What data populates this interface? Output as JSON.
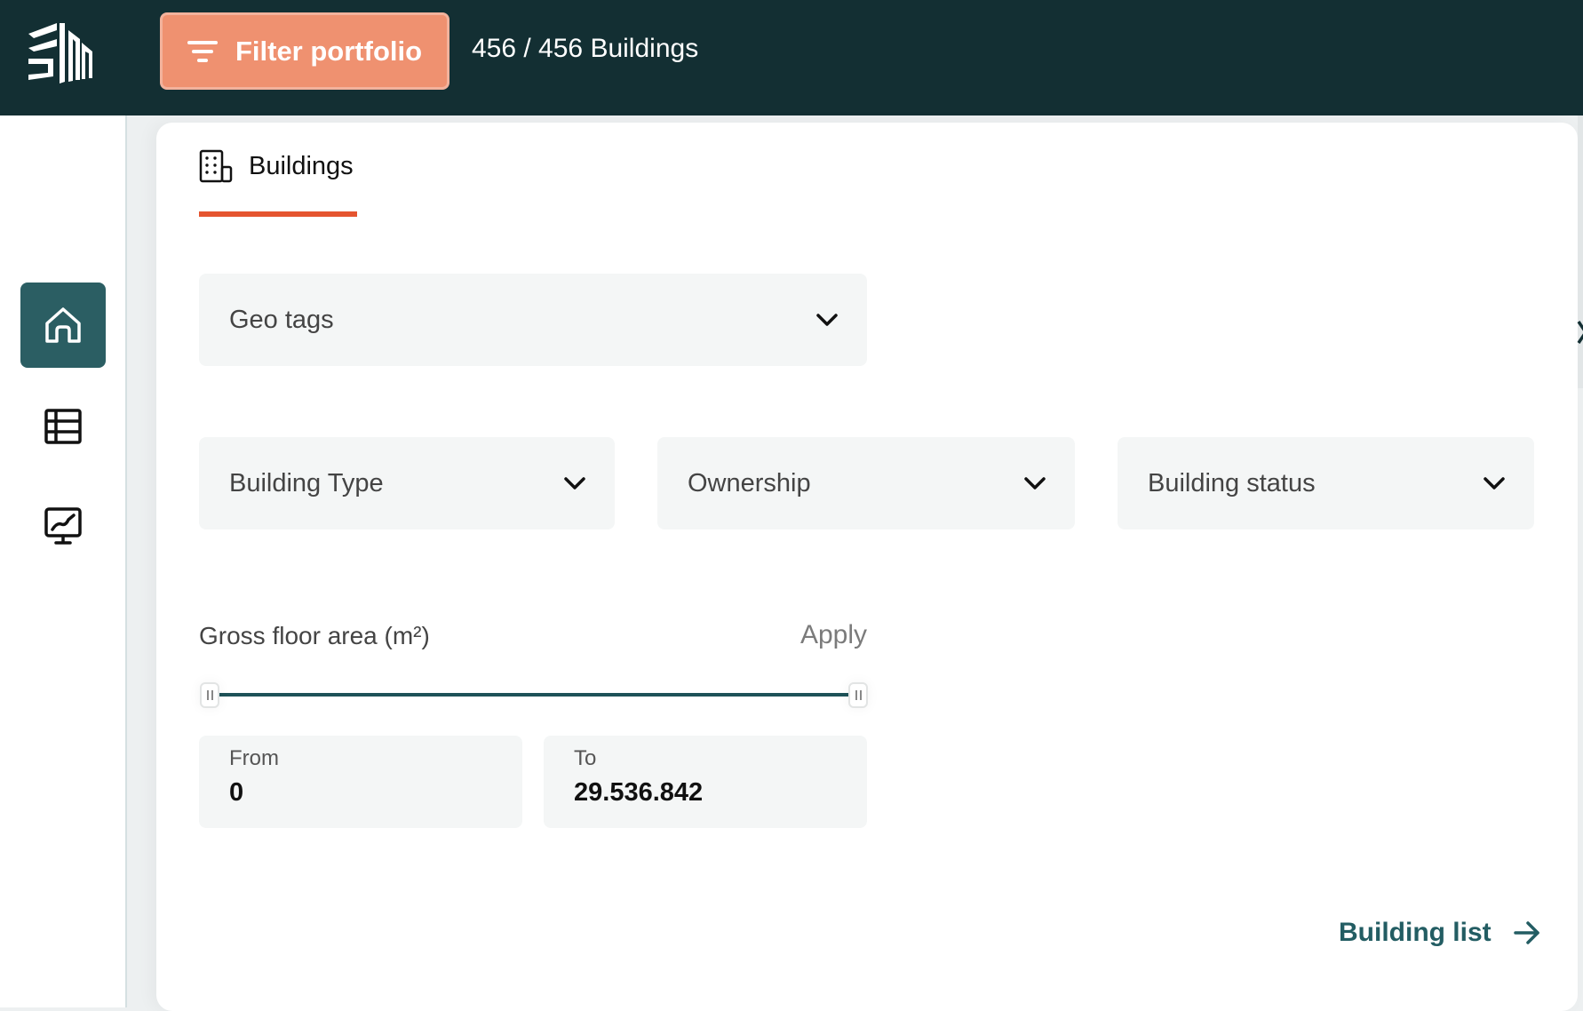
{
  "header": {
    "logo": "company-logo",
    "filter_button_label": "Filter portfolio",
    "filter_icon": "filter-lines-icon",
    "building_count": "456 / 456 Buildings"
  },
  "sidebar": {
    "items": [
      {
        "name": "home",
        "icon": "home-icon",
        "active": true
      },
      {
        "name": "table",
        "icon": "table-icon",
        "active": false
      },
      {
        "name": "analytics",
        "icon": "monitor-chart-icon",
        "active": false
      }
    ]
  },
  "tabs": [
    {
      "label": "Buildings",
      "icon": "building-icon",
      "active": true
    }
  ],
  "filters": {
    "geo_tags": "Geo tags",
    "building_type": "Building Type",
    "ownership": "Ownership",
    "building_status": "Building status"
  },
  "gross_floor_area": {
    "label": "Gross floor area (m²)",
    "apply_label": "Apply",
    "from_label": "From",
    "from_value": "0",
    "to_label": "To",
    "to_value": "29.536.842",
    "range_fraction": [
      0,
      1
    ]
  },
  "footer": {
    "building_list_label": "Building list",
    "arrow_icon": "arrow-right-icon"
  },
  "colors": {
    "header_bg": "#132F33",
    "accent_orange": "#EF9170",
    "tab_underline": "#E5542F",
    "primary_teal": "#2B5E63"
  }
}
